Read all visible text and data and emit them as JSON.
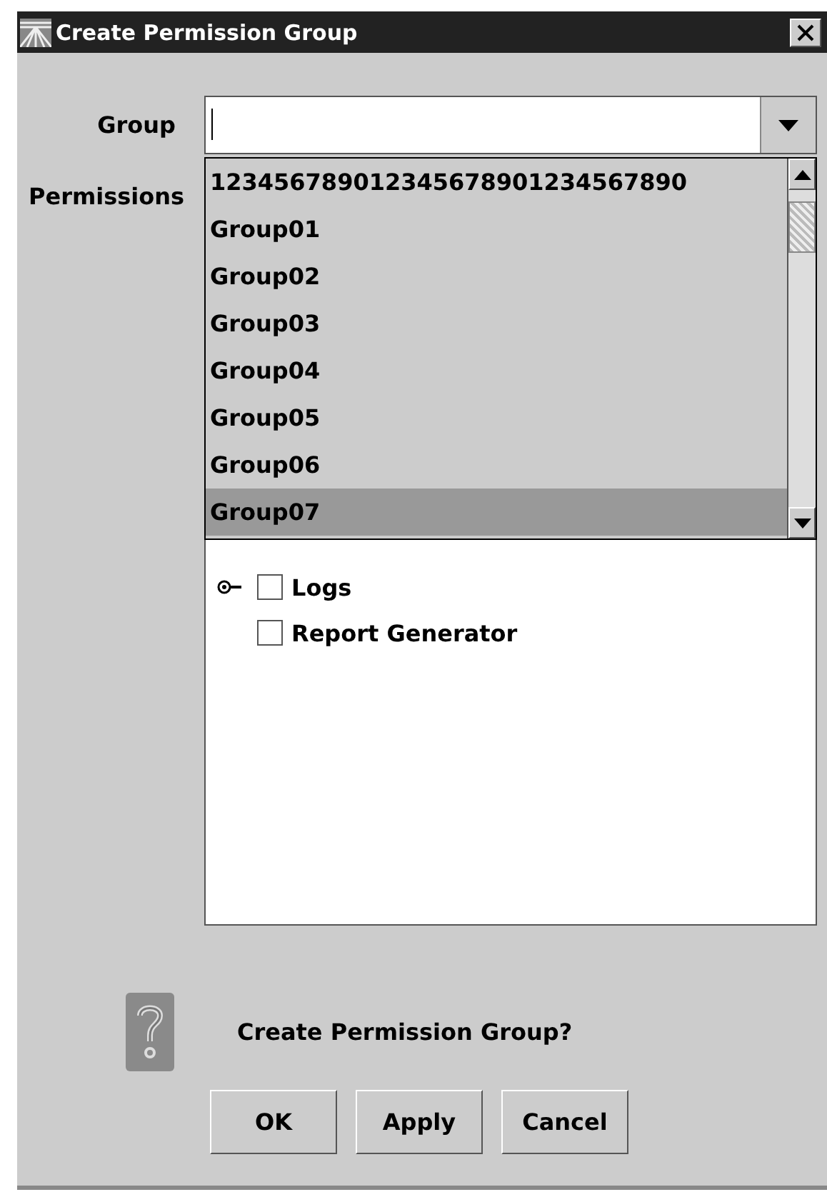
{
  "window": {
    "title": "Create Permission Group"
  },
  "group_field": {
    "label": "Group"
  },
  "dropdown": {
    "items": [
      {
        "label": "123456789012345678901234567890",
        "selected": false
      },
      {
        "label": "Group01",
        "selected": false
      },
      {
        "label": "Group02",
        "selected": false
      },
      {
        "label": "Group03",
        "selected": false
      },
      {
        "label": "Group04",
        "selected": false
      },
      {
        "label": "Group05",
        "selected": false
      },
      {
        "label": "Group06",
        "selected": false
      },
      {
        "label": "Group07",
        "selected": true
      }
    ]
  },
  "permissions": {
    "label": "Permissions",
    "tree": [
      {
        "label": "Logs",
        "checked": false,
        "expandable": true
      },
      {
        "label": "Report Generator",
        "checked": false,
        "expandable": false
      }
    ]
  },
  "message": "Create Permission Group?",
  "buttons": [
    "OK",
    "Apply",
    "Cancel"
  ]
}
